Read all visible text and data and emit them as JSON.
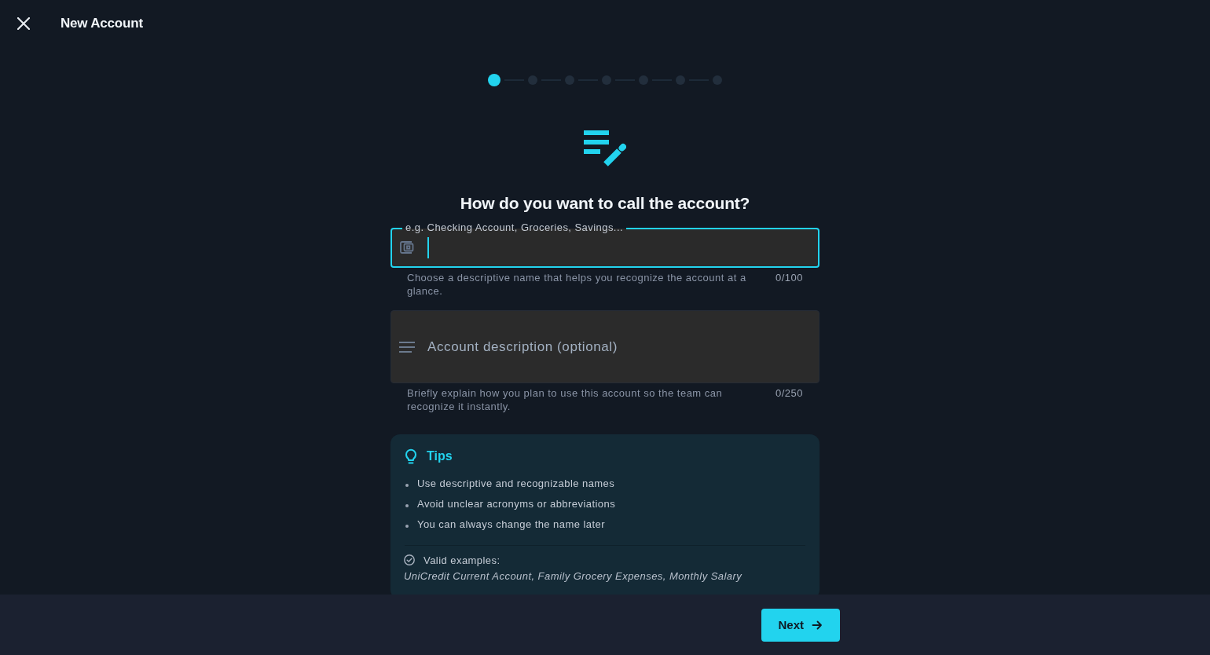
{
  "header": {
    "title": "New Account"
  },
  "stepper": {
    "steps": [
      {
        "selected": true
      },
      {
        "selected": false
      },
      {
        "selected": false
      },
      {
        "selected": false
      },
      {
        "selected": false
      },
      {
        "selected": false
      },
      {
        "selected": false
      }
    ]
  },
  "heading": "How do you want to call the account?",
  "name_field": {
    "label": "e.g. Checking Account, Groceries, Savings...",
    "focused": true,
    "helper": "Choose a descriptive name that helps you recognize the account at a glance.",
    "counter": "0/100"
  },
  "description_field": {
    "placeholder": "Account description (optional)",
    "helper": "Briefly explain how you plan to use this account so the team can recognize it instantly.",
    "counter": "0/250"
  },
  "tips": {
    "title": "Tips",
    "items": [
      "Use descriptive and recognizable names",
      "Avoid unclear acronyms or abbreviations",
      "You can always change the name later"
    ],
    "examples_label": "Valid examples:",
    "examples": "UniCredit Current Account, Family Grocery Expenses, Monthly Salary"
  },
  "footer": {
    "next_button": "Next"
  }
}
